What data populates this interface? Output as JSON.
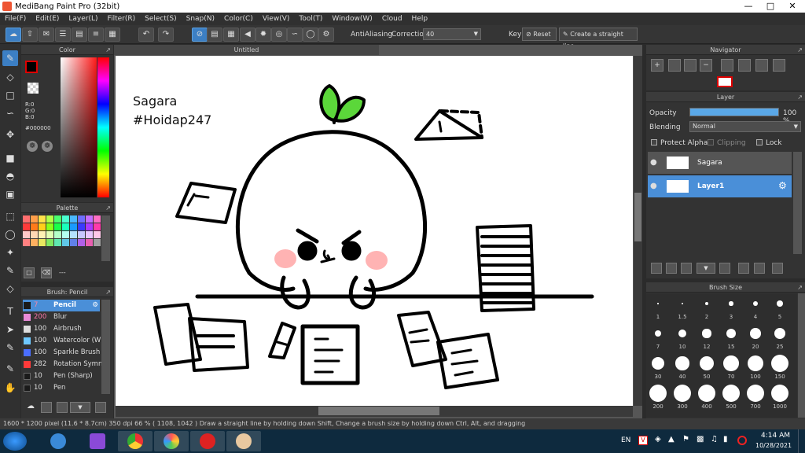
{
  "app": {
    "title": "MediBang Paint Pro (32bit)"
  },
  "menu": [
    "File(F)",
    "Edit(E)",
    "Layer(L)",
    "Filter(R)",
    "Select(S)",
    "Snap(N)",
    "Color(C)",
    "View(V)",
    "Tool(T)",
    "Window(W)",
    "Cloud",
    "Help"
  ],
  "toolbar": {
    "antialiasing_label": "AntiAliasing",
    "correction_label": "Correction",
    "correction_value": "40",
    "key_label": "Key",
    "reset_label": "Reset",
    "straight_line_label": "Create a straight line"
  },
  "color_panel": {
    "title": "Color",
    "r": "R:0",
    "g": "G:0",
    "b": "B:0",
    "hex": "#000000"
  },
  "palette_panel": {
    "title": "Palette",
    "more": "---",
    "colors": [
      "#ff6e6e",
      "#ff9e4a",
      "#ffe14a",
      "#b4ff4a",
      "#4aff6e",
      "#4affd0",
      "#4ab8ff",
      "#6e6eff",
      "#c46eff",
      "#ff6ec4",
      "#ff3a3a",
      "#ff7a1a",
      "#ffd01a",
      "#8aff1a",
      "#1aff4a",
      "#1affbc",
      "#1a9aff",
      "#3a3aff",
      "#aa3aff",
      "#ff3aaa",
      "#ffc8c8",
      "#ffd8b4",
      "#fff2b4",
      "#e2ffb4",
      "#b4ffc8",
      "#b4fff0",
      "#b4e2ff",
      "#c8c8ff",
      "#e8c8ff",
      "#ffc8e8",
      "#ff8080",
      "#ffb060",
      "#e8e860",
      "#80e860",
      "#60e8b0",
      "#60c8e8",
      "#6080e8",
      "#b060e8",
      "#e860b0",
      "#a0a0a0"
    ]
  },
  "brush_panel": {
    "title": "Brush: Pencil",
    "brushes": [
      {
        "size": "7",
        "name": "Pencil",
        "color": "#1a1a1a"
      },
      {
        "size": "200",
        "name": "Blur",
        "color": "#e88ad8"
      },
      {
        "size": "100",
        "name": "Airbrush",
        "color": "#dddddd"
      },
      {
        "size": "100",
        "name": "Watercolor (W",
        "color": "#6ec8ff"
      },
      {
        "size": "100",
        "name": "Sparkle Brush",
        "color": "#4a6eff"
      },
      {
        "size": "282",
        "name": "Rotation Symn",
        "color": "#ff3a3a"
      },
      {
        "size": "10",
        "name": "Pen (Sharp)",
        "color": "#1a1a1a"
      },
      {
        "size": "10",
        "name": "Pen",
        "color": "#1a1a1a"
      }
    ]
  },
  "document": {
    "tab": "Untitled",
    "text_line1": "Sagara",
    "text_line2": "#Hoidap247"
  },
  "navigator_panel": {
    "title": "Navigator"
  },
  "layer_panel": {
    "title": "Layer",
    "opacity_label": "Opacity",
    "opacity_value": 100,
    "opacity_text": "100 %",
    "blending_label": "Blending",
    "blending_value": "Normal",
    "protect_alpha": "Protect Alpha",
    "clipping": "Clipping",
    "lock": "Lock",
    "layers": [
      {
        "name": "Sagara",
        "selected": false
      },
      {
        "name": "Layer1",
        "selected": true
      }
    ]
  },
  "brush_size_panel": {
    "title": "Brush Size",
    "sizes": [
      "1",
      "1.5",
      "2",
      "3",
      "4",
      "5",
      "7",
      "10",
      "12",
      "15",
      "20",
      "25",
      "30",
      "40",
      "50",
      "70",
      "100",
      "150",
      "200",
      "300",
      "400",
      "500",
      "700",
      "1000"
    ]
  },
  "status": {
    "text": "1600 * 1200 pixel   (11.6 * 8.7cm)   350 dpi   66 %   ( 1108, 1042 )   Draw a straight line by holding down Shift, Change a brush size by holding down Ctrl, Alt, and dragging"
  },
  "taskbar": {
    "lang": "EN",
    "time": "4:14 AM",
    "date": "10/28/2021"
  }
}
